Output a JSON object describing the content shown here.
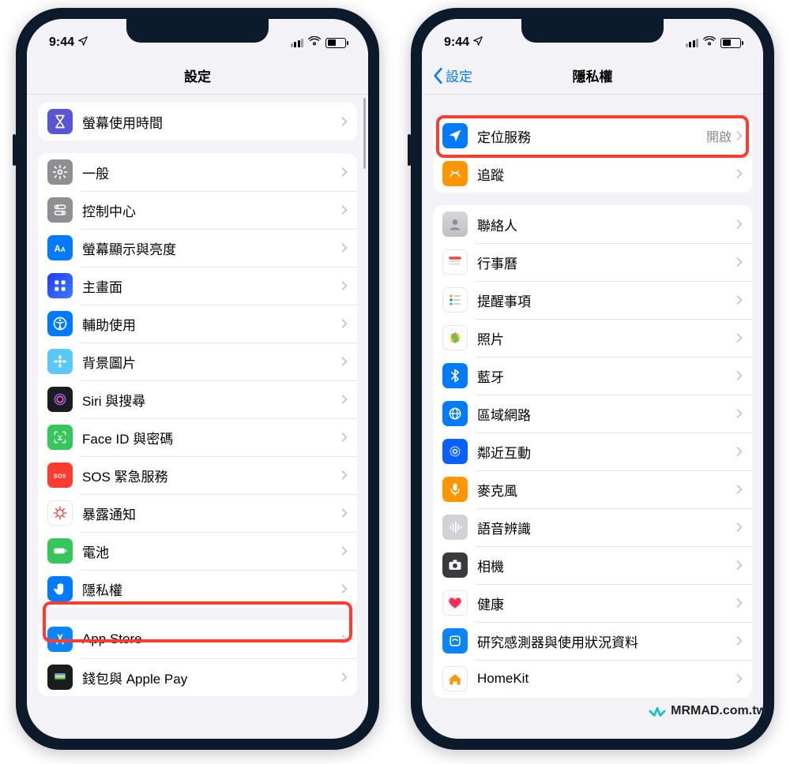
{
  "status": {
    "time": "9:44"
  },
  "watermark": "MRMAD.com.tw",
  "left": {
    "title": "設定",
    "groups": [
      {
        "rows": [
          {
            "key": "screentime",
            "label": "螢幕使用時間"
          }
        ]
      },
      {
        "rows": [
          {
            "key": "general",
            "label": "一般"
          },
          {
            "key": "control",
            "label": "控制中心"
          },
          {
            "key": "display",
            "label": "螢幕顯示與亮度"
          },
          {
            "key": "home",
            "label": "主畫面"
          },
          {
            "key": "access",
            "label": "輔助使用"
          },
          {
            "key": "wallpaper",
            "label": "背景圖片"
          },
          {
            "key": "siri",
            "label": "Siri 與搜尋"
          },
          {
            "key": "faceid",
            "label": "Face ID 與密碼"
          },
          {
            "key": "sos",
            "label": "SOS 緊急服務"
          },
          {
            "key": "exposure",
            "label": "暴露通知"
          },
          {
            "key": "battery",
            "label": "電池"
          },
          {
            "key": "privacy",
            "label": "隱私權"
          }
        ]
      },
      {
        "rows": [
          {
            "key": "appstore",
            "label": "App Store"
          },
          {
            "key": "wallet",
            "label": "錢包與 Apple Pay"
          }
        ]
      }
    ],
    "highlight_key": "privacy"
  },
  "right": {
    "back": "設定",
    "title": "隱私權",
    "groups": [
      {
        "rows": [
          {
            "key": "location",
            "label": "定位服務",
            "detail": "開啟"
          },
          {
            "key": "tracking",
            "label": "追蹤"
          }
        ]
      },
      {
        "rows": [
          {
            "key": "contacts",
            "label": "聯絡人"
          },
          {
            "key": "calendar",
            "label": "行事曆"
          },
          {
            "key": "reminders",
            "label": "提醒事項"
          },
          {
            "key": "photos",
            "label": "照片"
          },
          {
            "key": "bluetooth",
            "label": "藍牙"
          },
          {
            "key": "localnet",
            "label": "區域網路"
          },
          {
            "key": "nearby",
            "label": "鄰近互動"
          },
          {
            "key": "mic",
            "label": "麥克風"
          },
          {
            "key": "speech",
            "label": "語音辨識"
          },
          {
            "key": "camera",
            "label": "相機"
          },
          {
            "key": "health",
            "label": "健康"
          },
          {
            "key": "research",
            "label": "研究感測器與使用狀況資料"
          },
          {
            "key": "homekit",
            "label": "HomeKit"
          }
        ]
      }
    ],
    "highlight_key": "location"
  }
}
